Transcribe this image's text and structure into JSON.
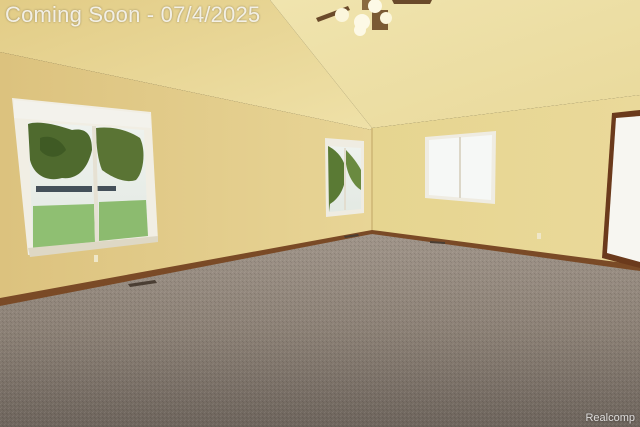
{
  "overlay": {
    "title": "Coming Soon - 07/4/2025",
    "watermark": "Realcomp"
  },
  "colors": {
    "wall_left": "#e5cf8a",
    "wall_right": "#e8d894",
    "ceiling": "#efe3ad",
    "carpet": "#8a7f74",
    "baseboard": "#7a4a26",
    "window_glass": "#f4f7f5",
    "trim": "#f2efe6"
  }
}
